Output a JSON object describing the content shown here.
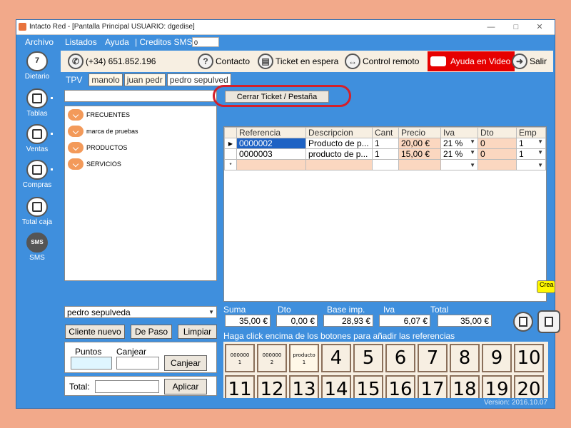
{
  "window": {
    "title": "Intacto Red - [Pantalla Principal USUARIO: dgedise]"
  },
  "menu": {
    "archivo": "Archivo",
    "listados": "Listados",
    "ayuda": "Ayuda",
    "creditos": "| Creditos SMS",
    "credit_value": "0"
  },
  "sidebar": {
    "items": [
      {
        "label": "Dietario",
        "icon": "calendar-icon"
      },
      {
        "label": "Tablas",
        "icon": "table-icon"
      },
      {
        "label": "Ventas",
        "icon": "sales-icon"
      },
      {
        "label": "Compras",
        "icon": "clipboard-icon"
      },
      {
        "label": "Total caja",
        "icon": "calculator-icon"
      },
      {
        "label": "SMS",
        "icon": "sms-icon",
        "icon_text": "SMS"
      }
    ],
    "calendar_day": "7"
  },
  "toolbar": {
    "phone": "(+34) 651.852.196",
    "contacto": "Contacto",
    "ticket_espera": "Ticket en espera",
    "control_remoto": "Control remoto",
    "ayuda_video": "Ayuda en Video",
    "salir": "Salir"
  },
  "tabs": [
    "TPV",
    "manolo",
    "juan pedr",
    "pedro sepulved"
  ],
  "cerrar_ticket": "Cerrar Ticket / Pestaña",
  "categories": [
    "FRECUENTES",
    "marca de pruebas",
    "PRODUCTOS",
    "SERVICIOS"
  ],
  "grid": {
    "headers": [
      "Referencia",
      "Descripcion",
      "Cant",
      "Precio",
      "Iva",
      "Dto",
      "Emp"
    ],
    "rows": [
      {
        "ref": "0000002",
        "desc": "Producto de p...",
        "cant": "1",
        "precio": "20,00 €",
        "iva": "21 %",
        "dto": "0",
        "emp": "1"
      },
      {
        "ref": "0000003",
        "desc": "producto de p...",
        "cant": "1",
        "precio": "15,00 €",
        "iva": "21 %",
        "dto": "0",
        "emp": "1"
      }
    ],
    "new_row_marker": "*"
  },
  "customer": {
    "selected": "pedro sepulveda",
    "cliente_nuevo": "Cliente nuevo",
    "de_paso": "De Paso",
    "limpiar": "Limpiar"
  },
  "points": {
    "puntos_label": "Puntos",
    "canjear_label": "Canjear",
    "canjear_button": "Canjear"
  },
  "total_input": {
    "label": "Total:",
    "aplicar": "Aplicar"
  },
  "summary": {
    "suma_label": "Suma",
    "suma": "35,00 €",
    "dto_label": "Dto",
    "dto": "0,00 €",
    "base_label": "Base imp.",
    "base": "28,93 €",
    "iva_label": "Iva",
    "iva": "6,07 €",
    "total_label": "Total",
    "total": "35,00 €"
  },
  "hint": "Haga click encima de los botones para añadir las referencias",
  "keypad": {
    "small": [
      {
        "top": "000000",
        "bottom": "1"
      },
      {
        "top": "000000",
        "bottom": "2"
      },
      {
        "top": "producto",
        "bottom": "1"
      }
    ],
    "numbers": [
      "4",
      "5",
      "6",
      "7",
      "8",
      "9",
      "10",
      "11",
      "12",
      "13",
      "14",
      "15",
      "16",
      "17",
      "18",
      "19",
      "20"
    ]
  },
  "crea": "Crea",
  "version": "Version: 2016.10.07"
}
